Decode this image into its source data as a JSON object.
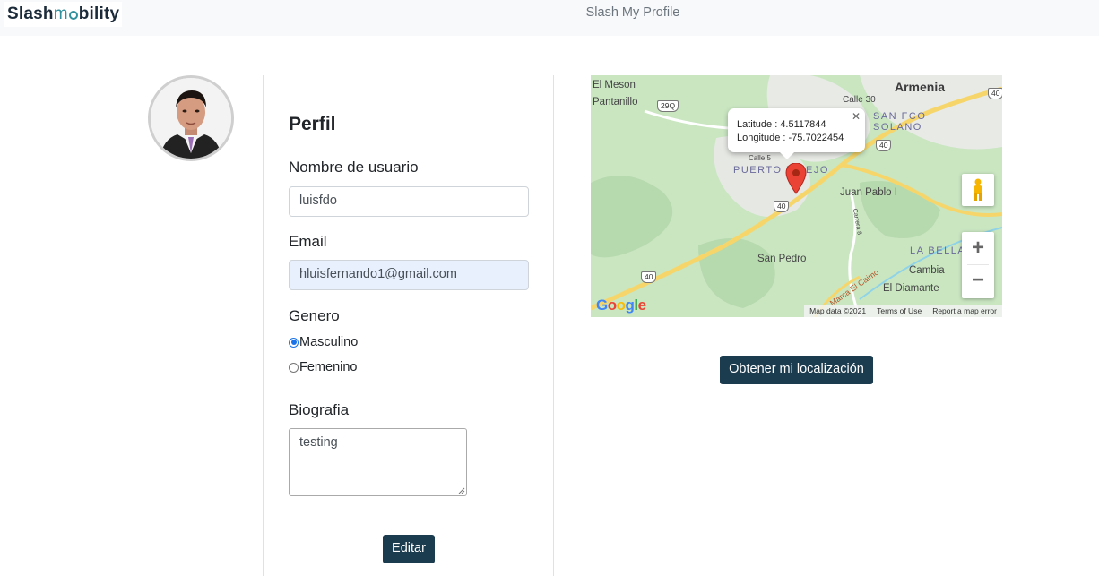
{
  "header": {
    "logo_text_a": "Slash",
    "logo_text_b": "m",
    "logo_text_c": "bility",
    "title": "Slash My Profile"
  },
  "profile": {
    "heading": "Perfil",
    "username_label": "Nombre de usuario",
    "username_value": "luisfdo",
    "email_label": "Email",
    "email_value": "hluisfernando1@gmail.com",
    "gender_label": "Genero",
    "gender_options": [
      {
        "label": "Masculino",
        "checked": true
      },
      {
        "label": "Femenino",
        "checked": false
      }
    ],
    "bio_label": "Biografia",
    "bio_value": "testing",
    "edit_button": "Editar"
  },
  "map": {
    "info_lat": "Latitude : 4.5117844",
    "info_lng": "Longitude : -75.7022454",
    "labels": {
      "armenia": "Armenia",
      "el_meson": "El Meson",
      "pantanillo": "Pantanillo",
      "calle30": "Calle 30",
      "san_fco_1": "SAN FCO",
      "san_fco_2": "SOLANO",
      "puerto": "PUERTO E",
      "puerto2": "EJO",
      "juan_pablo": "Juan Pablo I",
      "la_bella": "LA BELLA",
      "san_pedro": "San Pedro",
      "cambia": "Cambia",
      "el_diamante": "El Diamante",
      "carrera": "Carrera 8",
      "marca": "Marca El Caimo",
      "calle_sm": "Calle 5"
    },
    "shields": [
      "29Q",
      "40",
      "40",
      "40",
      "40"
    ],
    "zoom_in": "+",
    "zoom_out": "−",
    "google": "Google",
    "attribution": [
      "Map data ©2021",
      "Terms of Use",
      "Report a map error"
    ],
    "location_button": "Obtener mi localización"
  }
}
